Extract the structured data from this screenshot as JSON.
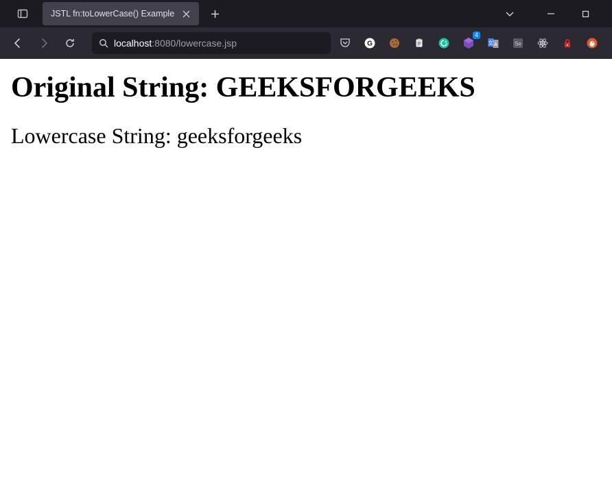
{
  "browser": {
    "tab_title": "JSTL fn:toLowerCase() Example",
    "url_host": "localhost",
    "url_port": ":8080",
    "url_path": "/lowercase.jsp"
  },
  "extensions": {
    "badge_count": "4"
  },
  "page": {
    "heading1": "Original String: GEEKSFORGEEKS",
    "heading2": "Lowercase String: geeksforgeeks"
  }
}
